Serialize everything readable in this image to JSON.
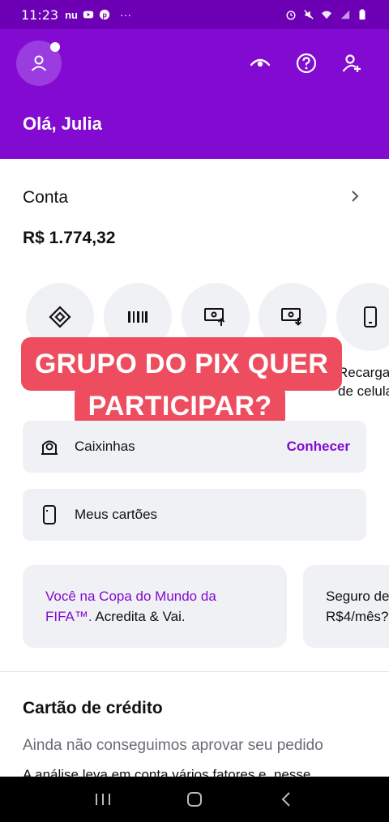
{
  "status_bar": {
    "time": "11:23",
    "left_icons": [
      "nubank-icon",
      "youtube-icon",
      "pinterest-icon",
      "more-icon"
    ],
    "right_icons": [
      "alarm-icon",
      "mute-icon",
      "wifi-icon",
      "signal-icon",
      "battery-icon"
    ]
  },
  "header": {
    "greeting": "Olá, Julia",
    "icons": [
      "profile-icon",
      "eye-icon",
      "help-icon",
      "add-user-icon"
    ]
  },
  "account": {
    "title": "Conta",
    "balance": "R$ 1.774,32"
  },
  "shortcuts": [
    {
      "icon": "pix-icon"
    },
    {
      "icon": "barcode-icon"
    },
    {
      "icon": "transfer-out-icon"
    },
    {
      "icon": "deposit-icon"
    },
    {
      "icon": "phone-icon",
      "label_line1": "Recarga",
      "label_line2": "de celular"
    }
  ],
  "overlay": {
    "line1": "GRUPO DO PIX QUER",
    "line2": "PARTICIPAR?"
  },
  "cards": {
    "savings": {
      "label": "Caixinhas",
      "action": "Conhecer"
    },
    "my_cards": {
      "label": "Meus cartões"
    }
  },
  "promos": [
    {
      "highlight": "Você na Copa do Mundo da FIFA™.",
      "text": " Acredita & Vai."
    },
    {
      "line1": "Seguro de",
      "line2": "R$4/mês?"
    }
  ],
  "credit_card": {
    "title": "Cartão de crédito",
    "subtitle": "Ainda não conseguimos aprovar seu pedido",
    "description": "A análise leva em conta vários fatores e, nesse"
  },
  "colors": {
    "brand": "#820ad1",
    "overlay": "#ee4d5f",
    "card_bg": "#f0f1f5"
  }
}
